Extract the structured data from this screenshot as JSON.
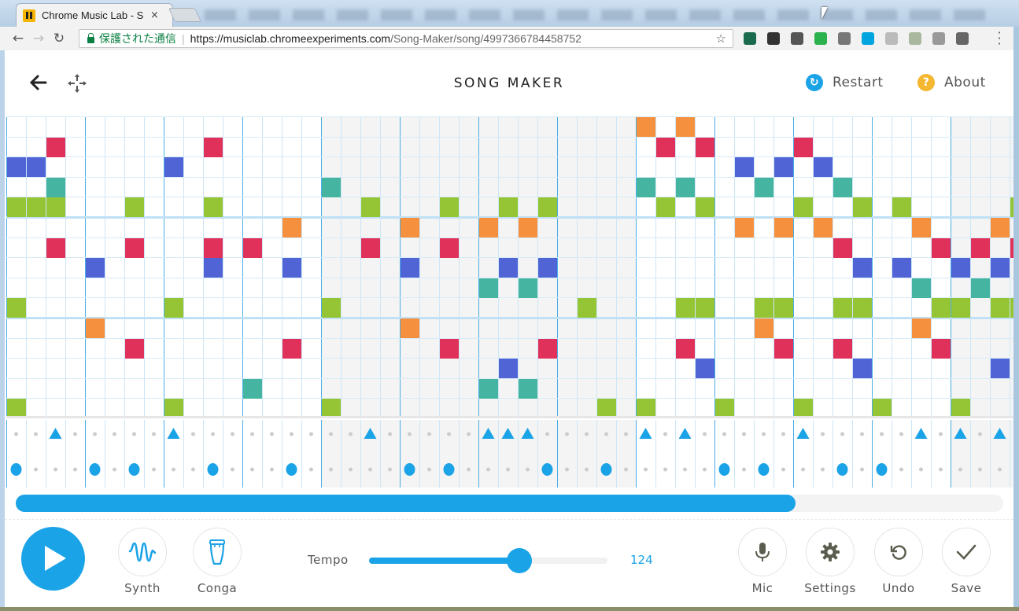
{
  "browser": {
    "tab_title": "Chrome Music Lab - Song Maker",
    "tab_close": "×",
    "secure_label": "保護された通信",
    "url_scheme_host": "https://musiclab.chromeexperiments.com",
    "url_path": "/Song-Maker/song/4997366784458752",
    "extensions": [
      {
        "name": "notion-clipper-icon",
        "color": "#1a6b4e"
      },
      {
        "name": "evernote-icon",
        "color": "#333333"
      },
      {
        "name": "pocket-icon",
        "color": "#555555"
      },
      {
        "name": "feedly-icon",
        "color": "#2bb24c"
      },
      {
        "name": "mail-icon",
        "color": "#777777"
      },
      {
        "name": "hatena-bookmark-icon",
        "color": "#00a4de"
      },
      {
        "name": "mountain-icon",
        "color": "#bbbbbb"
      },
      {
        "name": "butterfly-icon",
        "color": "#aab8a0"
      },
      {
        "name": "inbox-check-icon",
        "color": "#999999"
      },
      {
        "name": "line-icon",
        "color": "#666666"
      }
    ]
  },
  "header": {
    "title": "SONG MAKER",
    "restart_label": "Restart",
    "about_label": "About",
    "about_glyph": "?",
    "restart_glyph": "↻"
  },
  "grid": {
    "columns": 51,
    "rows": 15,
    "beats_per_bar": 4,
    "shaded_column_ranges": [
      [
        16,
        31
      ],
      [
        48,
        51
      ]
    ],
    "row_colors": [
      "#f5913e",
      "#e0315a",
      "#5064d6",
      "#45b5a1",
      "#95c535",
      "#f5913e",
      "#e0315a",
      "#5064d6",
      "#45b5a1",
      "#95c535",
      "#f5913e",
      "#e0315a",
      "#5064d6",
      "#45b5a1",
      "#95c535"
    ],
    "notes": [
      [
        0,
        32
      ],
      [
        0,
        34
      ],
      [
        1,
        2
      ],
      [
        1,
        10
      ],
      [
        1,
        33
      ],
      [
        1,
        35
      ],
      [
        1,
        40
      ],
      [
        2,
        0
      ],
      [
        2,
        1
      ],
      [
        2,
        8
      ],
      [
        2,
        37
      ],
      [
        2,
        39
      ],
      [
        2,
        41
      ],
      [
        3,
        2
      ],
      [
        3,
        16
      ],
      [
        3,
        32
      ],
      [
        3,
        34
      ],
      [
        3,
        38
      ],
      [
        3,
        42
      ],
      [
        4,
        0
      ],
      [
        4,
        1
      ],
      [
        4,
        2
      ],
      [
        4,
        6
      ],
      [
        4,
        10
      ],
      [
        4,
        18
      ],
      [
        4,
        22
      ],
      [
        4,
        25
      ],
      [
        4,
        27
      ],
      [
        4,
        33
      ],
      [
        4,
        35
      ],
      [
        4,
        40
      ],
      [
        4,
        43
      ],
      [
        4,
        45
      ],
      [
        4,
        51
      ],
      [
        5,
        14
      ],
      [
        5,
        20
      ],
      [
        5,
        24
      ],
      [
        5,
        26
      ],
      [
        5,
        37
      ],
      [
        5,
        39
      ],
      [
        5,
        41
      ],
      [
        5,
        46
      ],
      [
        5,
        50
      ],
      [
        6,
        2
      ],
      [
        6,
        6
      ],
      [
        6,
        10
      ],
      [
        6,
        12
      ],
      [
        6,
        18
      ],
      [
        6,
        22
      ],
      [
        6,
        42
      ],
      [
        6,
        47
      ],
      [
        6,
        49
      ],
      [
        6,
        51
      ],
      [
        7,
        4
      ],
      [
        7,
        10
      ],
      [
        7,
        14
      ],
      [
        7,
        20
      ],
      [
        7,
        25
      ],
      [
        7,
        27
      ],
      [
        7,
        43
      ],
      [
        7,
        45
      ],
      [
        7,
        48
      ],
      [
        7,
        50
      ],
      [
        8,
        24
      ],
      [
        8,
        26
      ],
      [
        8,
        46
      ],
      [
        8,
        49
      ],
      [
        9,
        0
      ],
      [
        9,
        8
      ],
      [
        9,
        16
      ],
      [
        9,
        29
      ],
      [
        9,
        34
      ],
      [
        9,
        35
      ],
      [
        9,
        38
      ],
      [
        9,
        39
      ],
      [
        9,
        42
      ],
      [
        9,
        43
      ],
      [
        9,
        47
      ],
      [
        9,
        48
      ],
      [
        9,
        50
      ],
      [
        9,
        51
      ],
      [
        10,
        4
      ],
      [
        10,
        20
      ],
      [
        10,
        38
      ],
      [
        10,
        46
      ],
      [
        11,
        6
      ],
      [
        11,
        14
      ],
      [
        11,
        22
      ],
      [
        11,
        27
      ],
      [
        11,
        34
      ],
      [
        11,
        39
      ],
      [
        11,
        42
      ],
      [
        11,
        47
      ],
      [
        12,
        25
      ],
      [
        12,
        35
      ],
      [
        12,
        43
      ],
      [
        12,
        50
      ],
      [
        13,
        12
      ],
      [
        13,
        24
      ],
      [
        13,
        26
      ],
      [
        14,
        0
      ],
      [
        14,
        8
      ],
      [
        14,
        16
      ],
      [
        14,
        30
      ],
      [
        14,
        32
      ],
      [
        14,
        36
      ],
      [
        14,
        40
      ],
      [
        14,
        44
      ],
      [
        14,
        48
      ]
    ]
  },
  "percussion": {
    "color": "#1ba3e8",
    "triangle_columns": [
      2,
      8,
      18,
      24,
      25,
      26,
      32,
      34,
      40,
      46,
      48,
      50
    ],
    "circle_columns": [
      0,
      4,
      6,
      10,
      14,
      20,
      22,
      27,
      30,
      36,
      38,
      42,
      44
    ]
  },
  "playback": {
    "progress_percent": 79
  },
  "controls": {
    "instrument_label": "Synth",
    "percussion_label": "Conga",
    "tempo_label": "Tempo",
    "tempo_value": "124",
    "tempo_fraction": 0.63,
    "mic_label": "Mic",
    "settings_label": "Settings",
    "undo_label": "Undo",
    "save_label": "Save"
  }
}
